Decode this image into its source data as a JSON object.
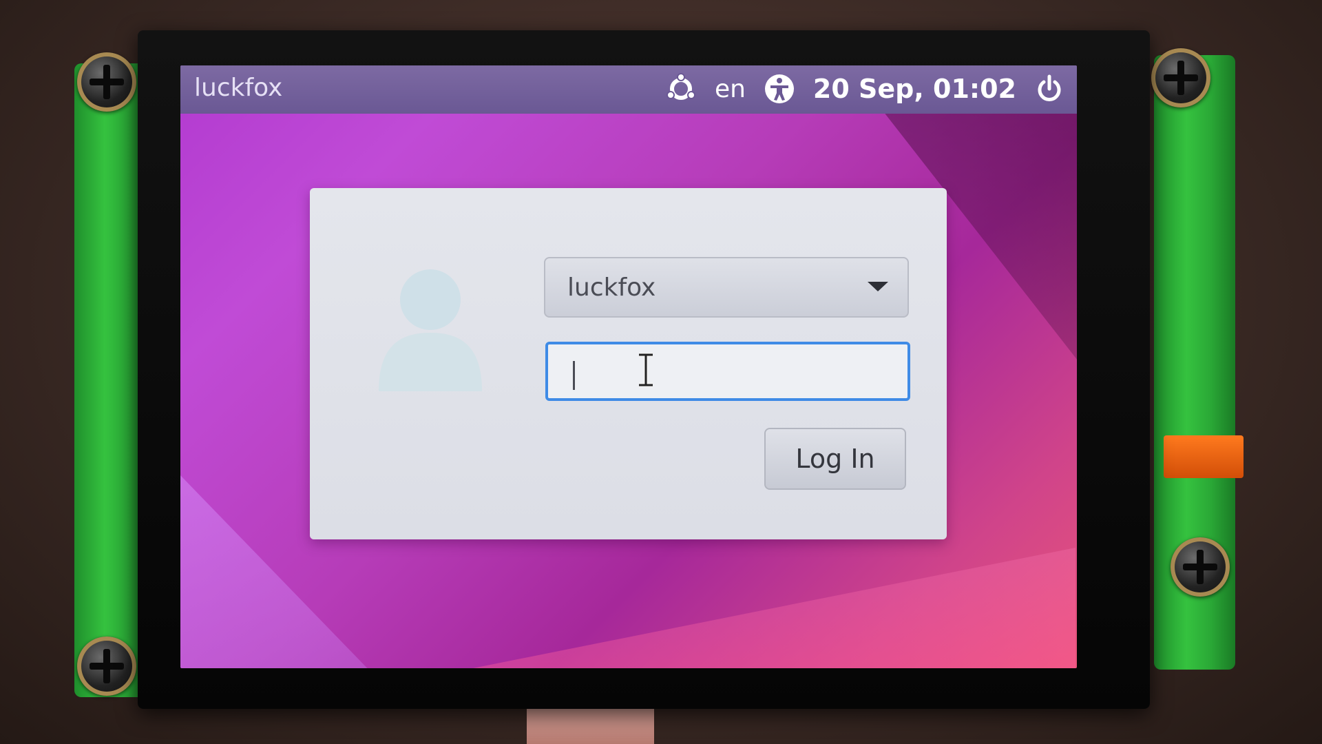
{
  "panel": {
    "hostname": "luckfox",
    "keyboard_layout": "en",
    "datetime": "20 Sep, 01:02",
    "icons": [
      "ubuntu-logo-icon",
      "accessibility-icon",
      "power-icon"
    ]
  },
  "login": {
    "selected_user": "luckfox",
    "password_value": "",
    "login_label": "Log In"
  },
  "colors": {
    "panel": "#6a5894",
    "dialog": "#e0e2e9",
    "focus_border": "#3f8be6",
    "wallpaper": "#b23ad0",
    "pcb": "#35c23f"
  }
}
